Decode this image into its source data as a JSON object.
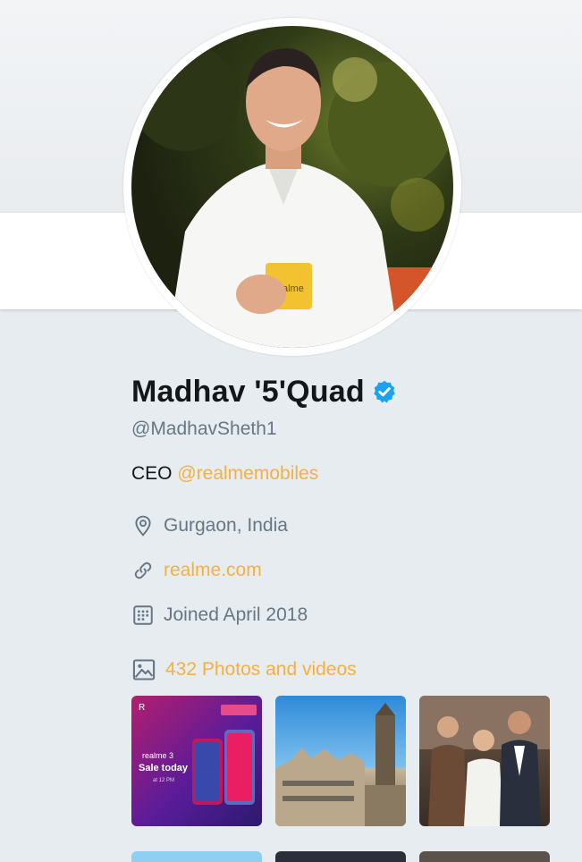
{
  "profile": {
    "display_name": "Madhav '5'Quad",
    "handle": "@MadhavSheth1",
    "bio_prefix": "CEO ",
    "bio_link": "@realmemobiles",
    "location": "Gurgaon, India",
    "website": "realme.com",
    "joined": "Joined April 2018",
    "photos_label": "432 Photos and videos",
    "verified": true
  },
  "colors": {
    "link": "#f5b042",
    "verified_badge": "#1da1f2",
    "secondary_text": "#657786"
  },
  "icons": [
    "verified-badge-icon",
    "location-pin-icon",
    "link-icon",
    "calendar-icon",
    "image-icon"
  ],
  "thumbs": {
    "t1_brand": "R",
    "t1_model": "realme 3",
    "t1_headline": "Sale today",
    "t1_time": "at 12 PM",
    "mug_text": "realme"
  }
}
